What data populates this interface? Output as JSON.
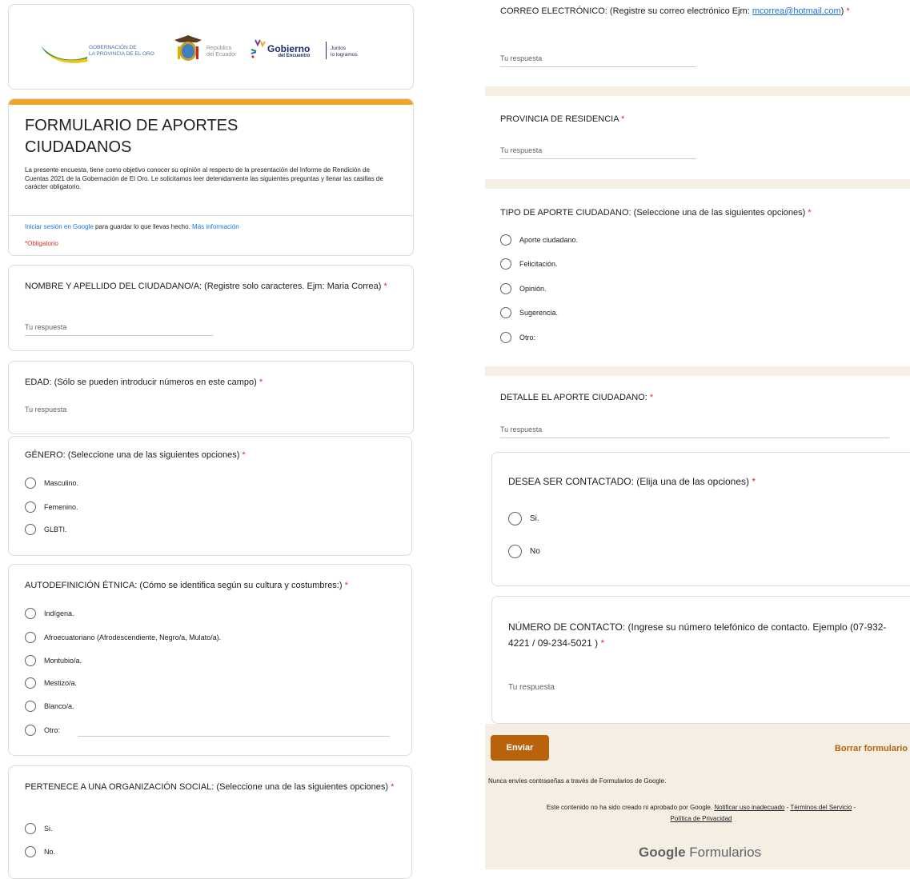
{
  "header": {
    "gov_el_oro_line1": "GOBERNACIÓN DE",
    "gov_el_oro_line2": "LA PROVINCIA DE EL ORO",
    "republica_line1": "República",
    "republica_line2": "del Ecuador",
    "gobierno_word": "Gobierno",
    "gobierno_sub": "del Encuentro",
    "juntos_line1": "Juntos",
    "juntos_line2": "lo logramos"
  },
  "form": {
    "title": "FORMULARIO DE APORTES CIUDADANOS",
    "description": "La presente encuesta, tiene como objetivo conocer su opinión al respecto de la presentación del Informe de Rendición de Cuentas 2021 de la Gobernación de El Oro. Le solicitamos leer detenidamente las siguientes preguntas y llenar las casillas de carácter obligatorio.",
    "signin_link": "Iniciar sesión en Google",
    "signin_text": " para guardar lo que llevas hecho. ",
    "more_info_link": "Más información",
    "required_note": "*Obligatorio"
  },
  "answer_placeholder": "Tu respuesta",
  "q_nombre": {
    "label": "NOMBRE Y APELLIDO DEL CIUDADANO/A: (Registre solo caracteres. Ejm: Maria Correa)"
  },
  "q_edad": {
    "label": "EDAD: (Sólo se pueden introducir números en este campo)"
  },
  "q_genero": {
    "label": "GÉNERO: (Seleccione una de las siguientes opciones)",
    "options": [
      "Masculino.",
      "Femenino.",
      "GLBTI."
    ]
  },
  "q_etnia": {
    "label": "AUTODEFINICIÓN ÉTNICA: (Cómo se identifica según su cultura y costumbres:)",
    "options": [
      "Indígena.",
      "Afroecuatoriano (Afrodescendiente, Negro/a, Mulato/a).",
      "Montubio/a.",
      "Mestizo/a.",
      "Blanco/a.",
      "Otro:"
    ]
  },
  "q_organizacion": {
    "label": "PERTENECE A UNA ORGANIZACIÓN SOCIAL: (Seleccione una de las siguientes opciones)",
    "options": [
      "Si.",
      "No."
    ]
  },
  "q_correo": {
    "label": "CORREO ELECTRÓNICO: (Registre su correo electrónico Ejm:",
    "email": "mcorrea@hotmail.com",
    "suffix": ")"
  },
  "q_provincia": {
    "label": "PROVINCIA DE RESIDENCIA"
  },
  "q_tipo": {
    "label": "TIPO DE APORTE CIUDADANO: (Seleccione una de las siguientes opciones)",
    "options": [
      "Aporte ciudadano.",
      "Felicitación.",
      "Opinión.",
      "Sugerencia.",
      "Otro:"
    ]
  },
  "q_detalle": {
    "label": "DETALLE EL APORTE CIUDADANO:"
  },
  "q_contacto": {
    "label": "DESEA SER CONTACTADO: (Elija una de las opciones)",
    "options": [
      "Si.",
      "No"
    ]
  },
  "q_numero": {
    "label": "NÚMERO DE CONTACTO: (Ingrese su número telefónico de contacto. Ejemplo (07-932-4221 / 09-234-5021 )"
  },
  "footer": {
    "submit_label": "Enviar",
    "clear_label": "Borrar formulario",
    "password_notice": "Nunca envíes contraseñas a través de Formularios de Google.",
    "disclaimer": "Este contenido no ha sido creado ni aprobado por Google.",
    "report_link": "Notificar uso inadecuado",
    "terms_link": "Términos del Servicio",
    "privacy_link": "Política de Privacidad",
    "brand_google": "Google",
    "brand_forms": "Formularios"
  },
  "colors": {
    "accent": "#b8620c",
    "header_bar": "#f2a628",
    "required": "#d93025",
    "link": "#1a73e8",
    "band": "#f5efe3"
  }
}
